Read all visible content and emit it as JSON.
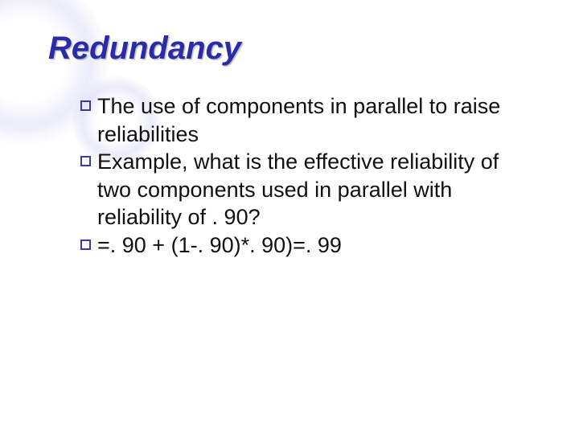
{
  "title": "Redundancy",
  "bullets": [
    "The use of components in parallel to raise reliabilities",
    "Example, what is the effective reliability of two components used in parallel with reliability of . 90?",
    "=. 90 + (1-. 90)*. 90)=. 99"
  ]
}
